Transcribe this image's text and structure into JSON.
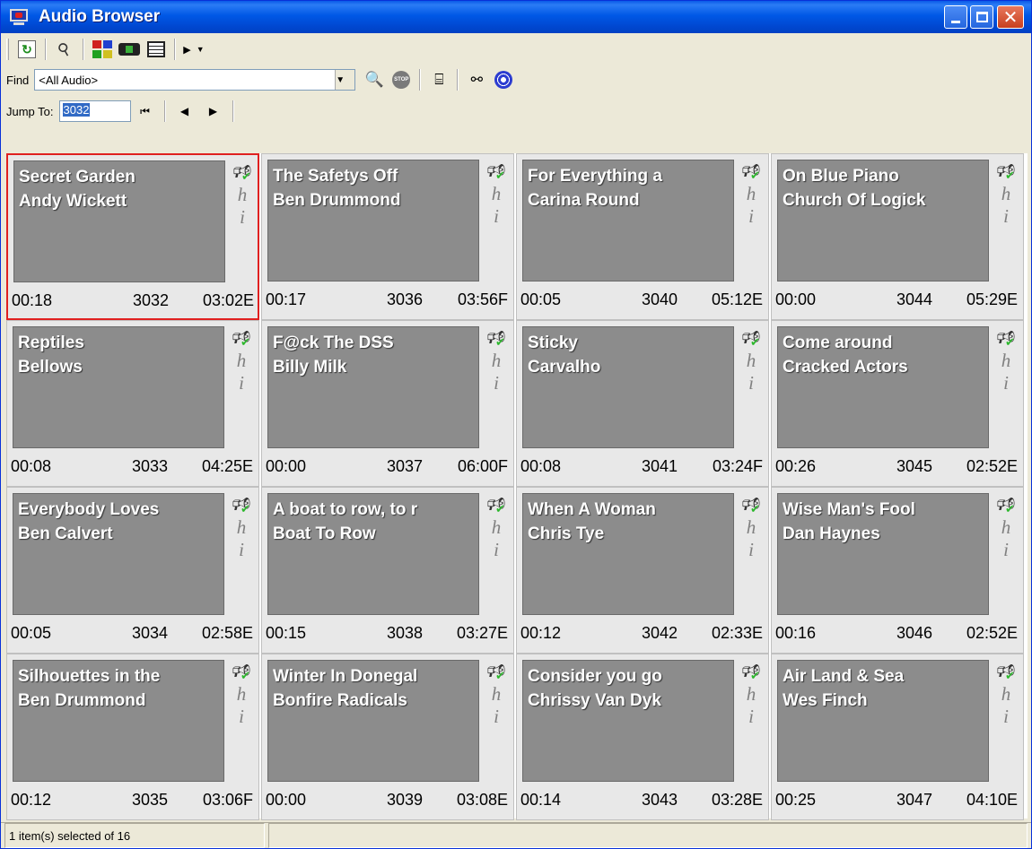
{
  "window": {
    "title": "Audio Browser"
  },
  "toolbar": {
    "icons": [
      "refresh-icon",
      "key-icon",
      "thumbnail-view-icon",
      "film-view-icon",
      "list-view-icon",
      "play-icon",
      "dropdown-arrow-icon"
    ]
  },
  "find": {
    "label": "Find",
    "value": "<All Audio>"
  },
  "jump": {
    "label": "Jump To:",
    "value": "3032"
  },
  "status": {
    "text": "1 item(s) selected of 16"
  },
  "colors": {
    "selected_border": "#e02020",
    "artwork": "#8c8c8c",
    "titlebar": "#0058e6"
  },
  "items": [
    {
      "title": "Secret Garden",
      "artist": "Andy Wickett",
      "elapsed": "00:18",
      "id": "3032",
      "duration": "03:02E"
    },
    {
      "title": "Reptiles",
      "artist": "Bellows",
      "elapsed": "00:08",
      "id": "3033",
      "duration": "04:25E"
    },
    {
      "title": "Everybody Loves",
      "artist": "Ben Calvert",
      "elapsed": "00:05",
      "id": "3034",
      "duration": "02:58E"
    },
    {
      "title": "Silhouettes in the",
      "artist": "Ben Drummond",
      "elapsed": "00:12",
      "id": "3035",
      "duration": "03:06F"
    },
    {
      "title": "The Safetys Off",
      "artist": "Ben Drummond",
      "elapsed": "00:17",
      "id": "3036",
      "duration": "03:56F"
    },
    {
      "title": "F@ck The DSS",
      "artist": "Billy Milk",
      "elapsed": "00:00",
      "id": "3037",
      "duration": "06:00F"
    },
    {
      "title": "A boat to row, to r",
      "artist": "Boat To Row",
      "elapsed": "00:15",
      "id": "3038",
      "duration": "03:27E"
    },
    {
      "title": "Winter In Donegal",
      "artist": "Bonfire Radicals",
      "elapsed": "00:00",
      "id": "3039",
      "duration": "03:08E"
    },
    {
      "title": "For Everything a",
      "artist": "Carina Round",
      "elapsed": "00:05",
      "id": "3040",
      "duration": "05:12E"
    },
    {
      "title": "Sticky",
      "artist": "Carvalho",
      "elapsed": "00:08",
      "id": "3041",
      "duration": "03:24F"
    },
    {
      "title": "When A Woman",
      "artist": "Chris Tye",
      "elapsed": "00:12",
      "id": "3042",
      "duration": "02:33E"
    },
    {
      "title": "Consider you go",
      "artist": "Chrissy Van Dyk",
      "elapsed": "00:14",
      "id": "3043",
      "duration": "03:28E"
    },
    {
      "title": "On Blue Piano",
      "artist": "Church Of Logick",
      "elapsed": "00:00",
      "id": "3044",
      "duration": "05:29E"
    },
    {
      "title": "Come around",
      "artist": "Cracked Actors",
      "elapsed": "00:26",
      "id": "3045",
      "duration": "02:52E"
    },
    {
      "title": "Wise Man's Fool",
      "artist": "Dan Haynes",
      "elapsed": "00:16",
      "id": "3046",
      "duration": "02:52E"
    },
    {
      "title": "Air Land & Sea",
      "artist": "Wes Finch",
      "elapsed": "00:25",
      "id": "3047",
      "duration": "04:10E"
    }
  ],
  "selected_id": "3032"
}
